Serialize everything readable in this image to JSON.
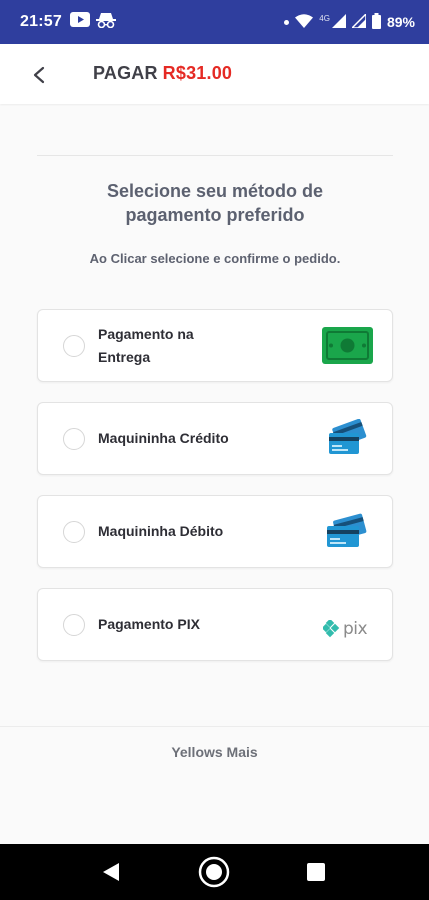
{
  "status_bar": {
    "time": "21:57",
    "battery": "89%",
    "network": "4G",
    "icons": [
      "youtube-icon",
      "incognito-icon",
      "dot-icon",
      "wifi-icon",
      "signal-icon",
      "signal-icon",
      "battery-icon"
    ]
  },
  "header": {
    "title": "PAGAR",
    "amount": "R$31.00",
    "back_icon": "chevron-left-icon"
  },
  "prompt": {
    "title_line1": "Selecione seu método de",
    "title_line2": "pagamento preferido",
    "subtitle": "Ao Clicar selecione e confirme o pedido."
  },
  "payment_options": [
    {
      "label_line1": "Pagamento na",
      "label_line2": "Entrega",
      "icon": "cash-icon",
      "selected": false
    },
    {
      "label": "Maquininha Crédito",
      "icon": "credit-card-icon",
      "selected": false
    },
    {
      "label": "Maquininha Débito",
      "icon": "debit-card-icon",
      "selected": false
    },
    {
      "label": "Pagamento PIX",
      "icon": "pix-logo-icon",
      "logo_text": "pix",
      "selected": false
    }
  ],
  "footer": {
    "text": "Yellows Mais"
  },
  "colors": {
    "status_bar": "#2f3e9e",
    "amount": "#e52a24",
    "cash_green": "#1aa64b",
    "card_blue": "#2196d3"
  }
}
